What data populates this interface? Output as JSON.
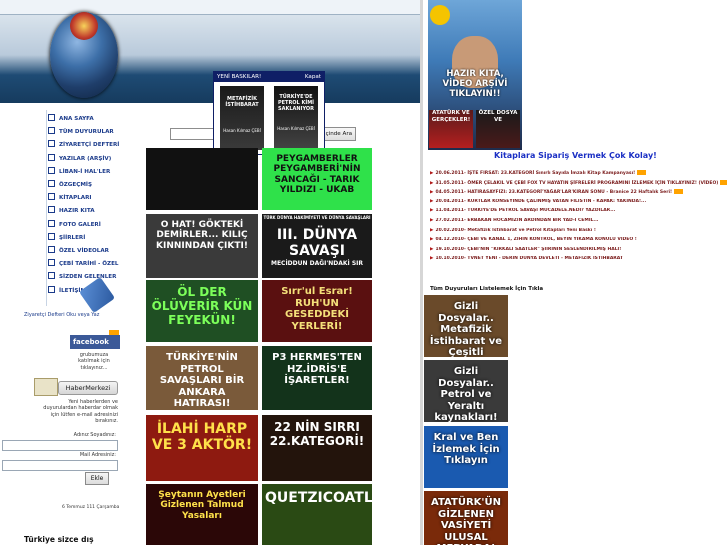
{
  "header": {
    "logo_icon": "globe-emblem-icon"
  },
  "nav": {
    "items": [
      "ANA SAYFA",
      "TÜM DUYURULAR",
      "ZİYARETÇİ DEFTERİ",
      "YAZILAR (ARŞİV)",
      "LİBAN-İ HAL'LER",
      "ÖZGEÇMİŞ",
      "KİTAPLARI",
      "HAZIR KITA",
      "FOTO GALERİ",
      "ŞİİRLERİ",
      "ÖZEL VİDEOLAR",
      "ÇEBİ TARİHİ - ÖZEL",
      "SİZDEN GELENLER",
      "İLETİŞİM"
    ]
  },
  "guestbook": {
    "caption": "Ziyaretçi Defteri Oku veya Yaz"
  },
  "facebook": {
    "label": "facebook",
    "text": "grubumuza katılmak için tıklayınız..."
  },
  "haber": {
    "label": "HaberMerkezi",
    "text": "Yeni haberlerden ve duyurulardan haberdar olmak için lütfen e-mail adresinizi bırakınız.",
    "name_label": "Adınız Soyadınız:",
    "email_label": "Mail Adresiniz:",
    "button": "Ekle"
  },
  "date": "6 Temmuz 111 Çarşamba",
  "bottom_left": "Türkiye sizce dış",
  "search": {
    "button": "İçinde Ara"
  },
  "popup": {
    "title": "YENİ BASKILAR!",
    "close": "Kapat",
    "books": [
      {
        "title": "METAFİZİK İSTİHBARAT",
        "author": "Hasan Kılmaz ÇEBİ"
      },
      {
        "title": "TÜRKİYE'DE PETROL KİMİ SAKLANIYOR",
        "author": "Hasan Kılmaz ÇEBİ"
      }
    ]
  },
  "tiles": [
    {
      "text": "",
      "bg": "#111111"
    },
    {
      "text": "PEYGAMBERLER PEYGAMBERİ'NİN SANCAĞI - TARIK YILDIZI - UKAB",
      "bg": "#2fe14a"
    },
    {
      "text": "O HAT! GÖKTEKİ DEMİRLER... KILIÇ KINNINDAN ÇIKTI!",
      "bg": "#3a3a3a"
    },
    {
      "text": "III. DÜNYA SAVAŞI",
      "sub": "MECİDDUN DAĞI'NDAKİ SIR",
      "top": "TÜRK DÜNYA HAKİMİYETİ VE DÜNYA SAVAŞLARI",
      "bg": "#1a1a1a"
    },
    {
      "text": "ÖL DER ÖLÜVERİR KÜN FEYEKÜN!",
      "bg": "#1f4f23"
    },
    {
      "text": "Sırr'ul Esrar! RUH'UN GESEDDEKİ YERLERİ!",
      "bg": "#5a1010"
    },
    {
      "text": "TÜRKİYE'NİN PETROL SAVAŞLARI BİR ANKARA HATIRASI!",
      "bg": "#7a5a3a"
    },
    {
      "text": "P3 HERMES'TEN HZ.İDRİS'E İŞARETLER!",
      "bg": "#13331b"
    },
    {
      "text": "İLAHİ HARP VE 3 AKTÖR!",
      "bg": "#8e1a10"
    },
    {
      "text": "22 NİN SIRRI 22.KATEGORİ!",
      "bg": "#23140c"
    },
    {
      "text": "Şeytanın Ayetleri Gizlenen Talmud Yasaları",
      "bg": "#2b0707"
    },
    {
      "text": "QUETZICOATL!",
      "bg": "#2a4a14"
    }
  ],
  "right": {
    "video_banner": "HAZIR KITA, VİDEO ARŞİVİ TIKLAYIN!!",
    "book1": "ATATÜRK VE GERÇEKLER!",
    "book2": "ÖZEL DOSYA VE",
    "order_title": "Kitaplara Sipariş Vermek Çok Kolay!",
    "news": [
      {
        "date": "20.06.2011",
        "text": "- İŞTE FIRSAT: 23.KATEGORİ Sınırlı Sayıda İmzalı Kitap Kampanyası!"
      },
      {
        "date": "31.05.2011",
        "text": "- ÖMER ÇELAKIL VE ÇEBİ FOX TV HAYATIN ŞİFRELERİ PROGRAMINI İZLEMEK İÇİN TIKLAYINIZ! (VİDEO)"
      },
      {
        "date": "04.05.2011",
        "text": "- HATIRASAYFIZI: 23.KATEGORİ'YAĞAR'LAR'KIRAN SONU - Branice 22 Haftalık Seri!"
      },
      {
        "date": "20.04.2011",
        "text": "- KURTLAR KONSEYİNDE ÇALINMIŞ VATAN FİLİSTİN - KAPAK: YAKINDA!..."
      },
      {
        "date": "11.04.2011",
        "text": "- TÜRKİYE'DE PETROL SAVAŞI MÜCADELE.NEDİ? YAZDILAR..."
      },
      {
        "date": "27.02.2011",
        "text": "- ERBAKAN HOCAMIZIN ARDINDAN BİR YAD-İ CEMİL..."
      },
      {
        "date": "20.02.2010",
        "text": "- Metafizik İstihbarat ve Petrol Kitapları Yeni Baskı !"
      },
      {
        "date": "04.12.2010",
        "text": "- ÇEBİ VE KANAL 1, ZİHİN KONTROL, BEYİN YIKAMA KONULU VİDEO !"
      },
      {
        "date": "19.10.2010",
        "text": "- ÇEBİ'NİN \"KIRKALI SAATLER\" ŞİİRİNİN SESLENDİRİLMİŞ HALİ!"
      },
      {
        "date": "10.10.2010",
        "text": "- TVNET YENİ - DERİN DÜNYA DEVLETİ - METAFİZİK İSTİHBARAT"
      }
    ],
    "all_label": "Tüm Duyuruları Listelemek İçin Tıkla",
    "tiles": [
      {
        "text": "Gizli Dosyalar.. Metafizik İstihbarat ve Çeşitli Konular.. İzleyin..",
        "bg": "#6a4a2a"
      },
      {
        "text": "Gizli Dosyalar.. Petrol ve Yeraltı kaynakları! İzleyin!",
        "bg": "#3a3a3a"
      },
      {
        "text": "Kral ve Ben İzlemek İçin Tıklayın",
        "bg": "#1a5ab0"
      },
      {
        "text": "ATATÜRK'ÜN GİZLENEN VASİYETİ ULUSAL MEDYADA!",
        "bg": "#7a2a0a"
      }
    ]
  },
  "colors": {
    "nav_text": "#1a3a8a",
    "news_text": "#7a1b1b",
    "order_title": "#1a2fc4",
    "popup_bar": "#0f1f66"
  }
}
